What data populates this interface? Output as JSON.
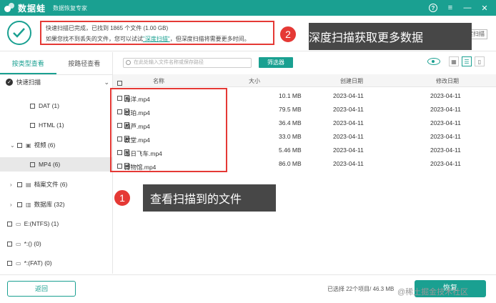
{
  "app": {
    "name": "数据蛙",
    "subtitle": "数据恢复专家",
    "accent": "#1aa091",
    "controls": {
      "help": "?",
      "menu": "≡",
      "minimize": "—",
      "close": "✕"
    }
  },
  "status": {
    "line1": "快速扫描已完成，已找到 1865 个文件 (1.00 GB)",
    "line2_pre": "如果您找不到丢失的文件，您可以试试",
    "line2_link": "\"深度扫描\"",
    "line2_post": "，但深度扫描将需要更多时间。",
    "deep_scan_button": "度扫描"
  },
  "callouts": {
    "top": {
      "badge": "2",
      "text": "深度扫描获取更多数据"
    },
    "middle": {
      "badge": "1",
      "text": "查看扫描到的文件"
    },
    "color": "#e53935"
  },
  "left_panel": {
    "tabs": [
      "按类型查看",
      "按路径查看"
    ],
    "tree": [
      {
        "label": "快速扫描",
        "kind": "root"
      },
      {
        "label": "DAT (1)",
        "kind": "child"
      },
      {
        "label": "HTML (1)",
        "kind": "child"
      },
      {
        "label": "视频 (6)",
        "kind": "group"
      },
      {
        "label": "MP4 (6)",
        "kind": "child-selected"
      },
      {
        "label": "档案文件 (6)",
        "kind": "group-collapsed"
      },
      {
        "label": "数据库 (32)",
        "kind": "group-collapsed"
      },
      {
        "label": "E:(NTFS) (1)",
        "kind": "drive"
      },
      {
        "label": "*:() (0)",
        "kind": "drive"
      },
      {
        "label": "*:(FAT) (0)",
        "kind": "drive"
      }
    ]
  },
  "toolbar": {
    "search_placeholder": "在此处输入文件名称或保存路径",
    "filter_button": "筛选器"
  },
  "table": {
    "columns": [
      "名称",
      "大小",
      "创建日期",
      "修改日期"
    ],
    "rows": [
      {
        "name": "海洋.mp4",
        "size": "10.1 MB",
        "created": "2023-04-11",
        "modified": "2023-04-11"
      },
      {
        "name": "琥珀.mp4",
        "size": "79.5 MB",
        "created": "2023-04-11",
        "modified": "2023-04-11"
      },
      {
        "name": "葫芦.mp4",
        "size": "36.4 MB",
        "created": "2023-04-11",
        "modified": "2023-04-11"
      },
      {
        "name": "教堂.mp4",
        "size": "33.0 MB",
        "created": "2023-04-11",
        "modified": "2023-04-11"
      },
      {
        "name": "落日飞车.mp4",
        "size": "5.46 MB",
        "created": "2023-04-11",
        "modified": "2023-04-11"
      },
      {
        "name": "博物馆.mp4",
        "size": "86.0 MB",
        "created": "2023-04-11",
        "modified": "2023-04-11"
      }
    ]
  },
  "footer": {
    "back_button": "返回",
    "selection_info": "已选择 22个项目/ 46.3 MB",
    "recover_button": "恢复",
    "watermark": "@稀土掘金技术社区"
  }
}
